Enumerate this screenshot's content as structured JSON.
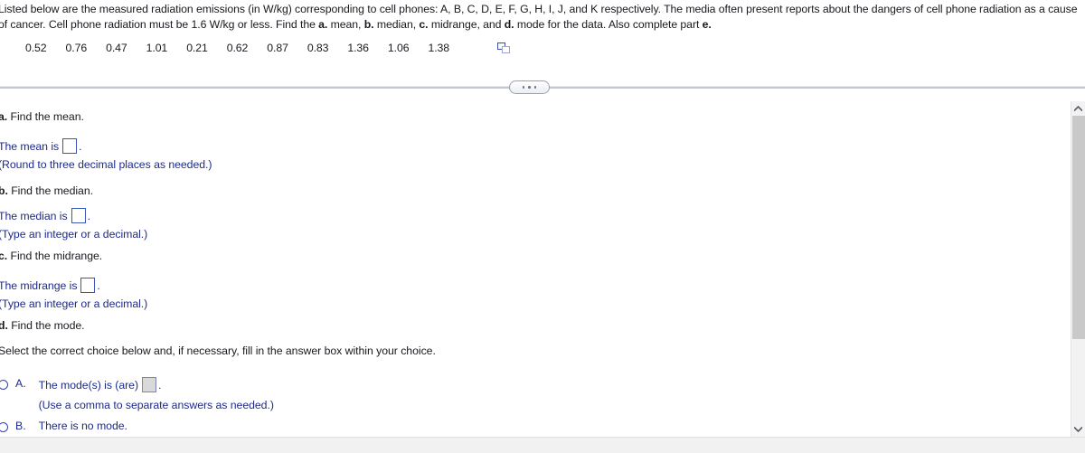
{
  "problem": {
    "statement_part1": "Listed below are the measured radiation emissions (in W/kg) corresponding to cell phones: A, B, C, D, E, F, G, H, I, J, and K respectively. The media often present reports about the dangers of cell phone radiation as a cause of cancer. Cell phone radiation must be 1.6 W/kg or less. Find the ",
    "bold_a": "a.",
    "text_mean": " mean, ",
    "bold_b": "b.",
    "text_median": " median, ",
    "bold_c": "c.",
    "text_midrange": " midrange, and ",
    "bold_d": "d.",
    "text_mode": " mode for the data. Also complete part ",
    "bold_e": "e.",
    "values": [
      "0.52",
      "0.76",
      "0.47",
      "1.01",
      "0.21",
      "0.62",
      "0.87",
      "0.83",
      "1.36",
      "1.06",
      "1.38"
    ],
    "copy_icon": "copy-icon"
  },
  "divider": {
    "handle_icon": "drag-handle-dots"
  },
  "questions": {
    "a": {
      "label": "a.",
      "prompt": " Find the mean.",
      "answer_line_prefix": "The mean is",
      "answer_line_suffix": ".",
      "answer_value": "",
      "hint": "(Round to three decimal places as needed.)"
    },
    "b": {
      "label": "b.",
      "prompt": " Find the median.",
      "answer_line_prefix": "The median is",
      "answer_line_suffix": ".",
      "answer_value": "",
      "hint": "(Type an integer or a decimal.)"
    },
    "c": {
      "label": "c.",
      "prompt": " Find the midrange.",
      "answer_line_prefix": "The midrange is",
      "answer_line_suffix": ".",
      "answer_value": "",
      "hint": "(Type an integer or a decimal.)"
    },
    "d": {
      "label": "d.",
      "prompt": " Find the mode.",
      "instruction": "Select the correct choice below and, if necessary, fill in the answer box within your choice.",
      "choices": [
        {
          "letter": "A.",
          "text_prefix": "The mode(s) is (are)",
          "text_suffix": ".",
          "answer_value": "",
          "sub_text": "(Use a comma to separate answers as needed.)",
          "selected": false
        },
        {
          "letter": "B.",
          "text_prefix": "There is no mode.",
          "text_suffix": "",
          "sub_text": "",
          "selected": false
        }
      ]
    }
  },
  "scrollbar": {
    "up_icon": "chevron-up-icon",
    "down_icon": "chevron-down-icon"
  }
}
